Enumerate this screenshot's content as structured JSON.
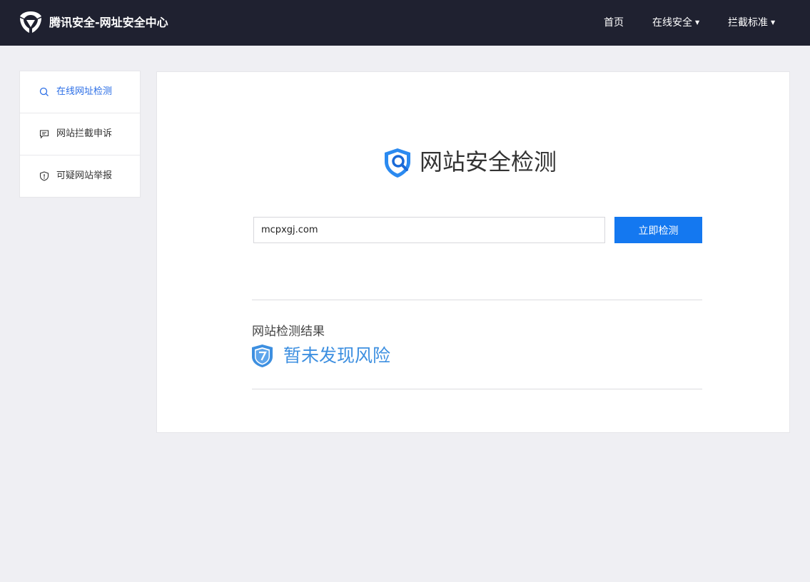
{
  "header": {
    "brand": "腾讯安全-网址安全中心",
    "nav": [
      {
        "label": "首页"
      },
      {
        "label": "在线安全"
      },
      {
        "label": "拦截标准"
      }
    ]
  },
  "sidebar": {
    "items": [
      {
        "label": "在线网址检测",
        "icon": "search-icon",
        "active": true
      },
      {
        "label": "网站拦截申诉",
        "icon": "message-icon",
        "active": false
      },
      {
        "label": "可疑网站举报",
        "icon": "shield-alert-icon",
        "active": false
      }
    ]
  },
  "main": {
    "title": "网站安全检测",
    "url_value": "mcpxgj.com",
    "button_label": "立即检测",
    "result_label": "网站检测结果",
    "result_status": "暂未发现风险"
  },
  "colors": {
    "topbar": "#1f2130",
    "accent": "#1478f0",
    "active_text": "#2b6ee6",
    "result_status": "#3d8fe0",
    "page_bg": "#efeff3"
  }
}
